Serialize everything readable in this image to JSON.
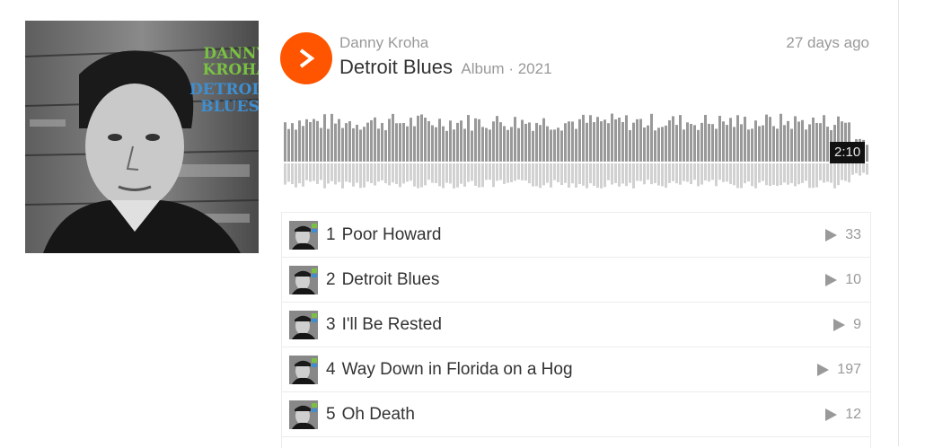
{
  "artwork": {
    "artist_text": "DANNY KROHA",
    "title_text": "DETROIT BLUES"
  },
  "header": {
    "artist": "Danny Kroha",
    "title": "Detroit Blues",
    "meta": "Album · 2021",
    "posted": "27 days ago"
  },
  "player": {
    "duration": "2:10",
    "accent_color": "#ff5500",
    "wave_color": "#999999"
  },
  "tracks": [
    {
      "number": "1",
      "title": "Poor Howard",
      "plays": "33"
    },
    {
      "number": "2",
      "title": "Detroit Blues",
      "plays": "10"
    },
    {
      "number": "3",
      "title": "I'll Be Rested",
      "plays": "9"
    },
    {
      "number": "4",
      "title": "Way Down in Florida on a Hog",
      "plays": "197"
    },
    {
      "number": "5",
      "title": "Oh Death",
      "plays": "12"
    }
  ],
  "icons": {
    "play": "play-icon",
    "track_play": "play-count-icon"
  }
}
